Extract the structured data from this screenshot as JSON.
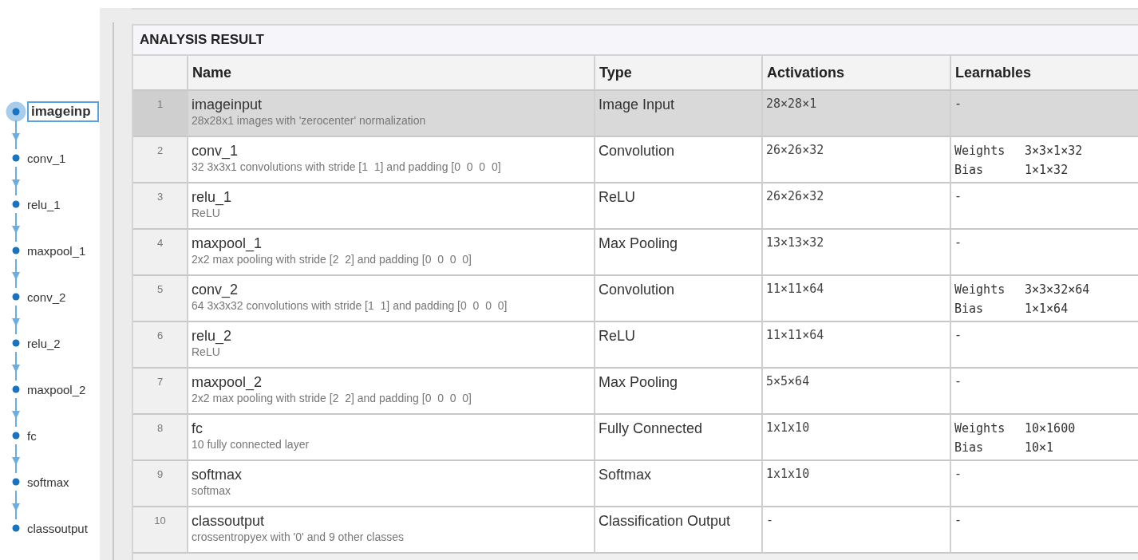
{
  "graph": {
    "nodes": [
      {
        "label": "imageinp",
        "selected": true
      },
      {
        "label": "conv_1",
        "selected": false
      },
      {
        "label": "relu_1",
        "selected": false
      },
      {
        "label": "maxpool_1",
        "selected": false
      },
      {
        "label": "conv_2",
        "selected": false
      },
      {
        "label": "relu_2",
        "selected": false
      },
      {
        "label": "maxpool_2",
        "selected": false
      },
      {
        "label": "fc",
        "selected": false
      },
      {
        "label": "softmax",
        "selected": false
      },
      {
        "label": "classoutput",
        "selected": false
      }
    ]
  },
  "analysis": {
    "title": "ANALYSIS RESULT",
    "columns": [
      "Name",
      "Type",
      "Activations",
      "Learnables"
    ],
    "rows": [
      {
        "number": "1",
        "name": "imageinput",
        "description": "28x28x1 images with 'zerocenter' normalization",
        "type": "Image Input",
        "activations": "28×28×1",
        "learnables": "-",
        "selected": true
      },
      {
        "number": "2",
        "name": "conv_1",
        "description": "32 3x3x1 convolutions with stride [1  1] and padding [0  0  0  0]",
        "type": "Convolution",
        "activations": "26×26×32",
        "learnables": [
          {
            "name": "Weights",
            "value": "3×3×1×32"
          },
          {
            "name": "Bias",
            "value": "1×1×32"
          }
        ],
        "selected": false
      },
      {
        "number": "3",
        "name": "relu_1",
        "description": "ReLU",
        "type": "ReLU",
        "activations": "26×26×32",
        "learnables": "-",
        "selected": false
      },
      {
        "number": "4",
        "name": "maxpool_1",
        "description": "2x2 max pooling with stride [2  2] and padding [0  0  0  0]",
        "type": "Max Pooling",
        "activations": "13×13×32",
        "learnables": "-",
        "selected": false
      },
      {
        "number": "5",
        "name": "conv_2",
        "description": "64 3x3x32 convolutions with stride [1  1] and padding [0  0  0  0]",
        "type": "Convolution",
        "activations": "11×11×64",
        "learnables": [
          {
            "name": "Weights",
            "value": "3×3×32×64"
          },
          {
            "name": "Bias",
            "value": "1×1×64"
          }
        ],
        "selected": false
      },
      {
        "number": "6",
        "name": "relu_2",
        "description": "ReLU",
        "type": "ReLU",
        "activations": "11×11×64",
        "learnables": "-",
        "selected": false
      },
      {
        "number": "7",
        "name": "maxpool_2",
        "description": "2x2 max pooling with stride [2  2] and padding [0  0  0  0]",
        "type": "Max Pooling",
        "activations": "5×5×64",
        "learnables": "-",
        "selected": false
      },
      {
        "number": "8",
        "name": "fc",
        "description": "10 fully connected layer",
        "type": "Fully Connected",
        "activations": "1x1x10",
        "learnables": [
          {
            "name": "Weights",
            "value": "10×1600"
          },
          {
            "name": "Bias",
            "value": "10×1"
          }
        ],
        "selected": false
      },
      {
        "number": "9",
        "name": "softmax",
        "description": "softmax",
        "type": "Softmax",
        "activations": "1x1x10",
        "learnables": "-",
        "selected": false
      },
      {
        "number": "10",
        "name": "classoutput",
        "description": "crossentropyex with '0' and 9 other classes",
        "type": "Classification Output",
        "activations": "-",
        "learnables": "-",
        "selected": false
      }
    ]
  }
}
